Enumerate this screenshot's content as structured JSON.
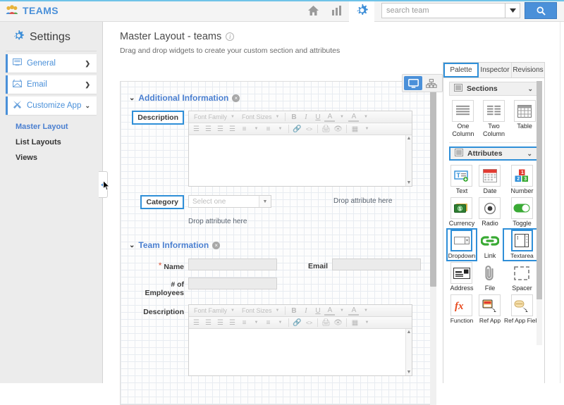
{
  "topbar": {
    "brand": "TEAMS",
    "icons": [
      "home-icon",
      "chart-icon",
      "gear-icon"
    ],
    "search": {
      "value": "search team",
      "placeholder": "search team"
    },
    "search_button": "search-icon"
  },
  "sidebar": {
    "title": "Settings",
    "items": [
      {
        "label": "General",
        "icon": "monitor-icon",
        "chevron": "❯"
      },
      {
        "label": "Email",
        "icon": "envelope-icon",
        "chevron": "❯"
      },
      {
        "label": "Customize App",
        "icon": "tools-icon",
        "chevron": "⌄"
      }
    ],
    "subitems": [
      {
        "label": "Master Layout",
        "active": true
      },
      {
        "label": "List Layouts",
        "active": false
      },
      {
        "label": "Views",
        "active": false
      }
    ]
  },
  "main": {
    "title": "Master Layout - teams",
    "info_icon": "i",
    "subtitle": "Drag and drop widgets to create your custom section and attributes",
    "device_toggle": [
      {
        "name": "desktop-view",
        "active": true
      },
      {
        "name": "responsive-view",
        "active": false
      }
    ]
  },
  "rte_toolbar": {
    "font_family": "Font Family",
    "font_sizes": "Font Sizes",
    "row1": [
      "B",
      "I",
      "U",
      "A",
      "A"
    ],
    "row2": [
      "align-left",
      "align-center",
      "align-right",
      "align-justify",
      "bullet-list",
      "number-list",
      "link",
      "code",
      "print",
      "preview",
      "table"
    ]
  },
  "sections": [
    {
      "name": "Additional Information",
      "delete": "×",
      "caret": "⌄",
      "fields": [
        {
          "label": "Description",
          "type": "richtext",
          "highlighted": true
        },
        {
          "label": "Category",
          "type": "select",
          "value": "Select one",
          "highlighted": true
        }
      ],
      "drop_hints": [
        "Drop attribute here",
        "Drop attribute here"
      ]
    },
    {
      "name": "Team Information",
      "delete": "×",
      "caret": "⌄",
      "fields": [
        {
          "label": "Name",
          "required": true,
          "type": "text"
        },
        {
          "label": "Email",
          "required": false,
          "type": "text"
        },
        {
          "label": "# of Employees",
          "required": false,
          "type": "text"
        },
        {
          "label": "Description",
          "type": "richtext",
          "highlighted": false
        }
      ]
    }
  ],
  "panel": {
    "tabs": [
      {
        "label": "Palette",
        "active": true
      },
      {
        "label": "Inspector",
        "active": false
      },
      {
        "label": "Revisions",
        "active": false
      }
    ],
    "groups": [
      {
        "title": "Sections",
        "icon": "section-icon",
        "caret": "⌄",
        "highlighted": false,
        "items": [
          {
            "label": "One Column",
            "icon": "one-column-icon",
            "highlighted": false
          },
          {
            "label": "Two Column",
            "icon": "two-column-icon",
            "highlighted": false
          },
          {
            "label": "Table",
            "icon": "table-icon",
            "highlighted": false
          }
        ]
      },
      {
        "title": "Attributes",
        "icon": "attributes-icon",
        "caret": "⌄",
        "highlighted": true,
        "items": [
          {
            "label": "Text",
            "icon": "text-field-icon",
            "highlighted": false
          },
          {
            "label": "Date",
            "icon": "calendar-icon",
            "highlighted": false
          },
          {
            "label": "Number",
            "icon": "number-blocks-icon",
            "highlighted": false
          },
          {
            "label": "Currency",
            "icon": "money-icon",
            "highlighted": false
          },
          {
            "label": "Radio",
            "icon": "radio-button-icon",
            "highlighted": false
          },
          {
            "label": "Toggle",
            "icon": "toggle-switch-icon",
            "highlighted": false
          },
          {
            "label": "Dropdown",
            "icon": "dropdown-icon",
            "highlighted": true
          },
          {
            "label": "Link",
            "icon": "link-chain-icon",
            "highlighted": false
          },
          {
            "label": "Textarea",
            "icon": "textarea-icon",
            "highlighted": true
          },
          {
            "label": "Address",
            "icon": "address-card-icon",
            "highlighted": false
          },
          {
            "label": "File",
            "icon": "paperclip-icon",
            "highlighted": false
          },
          {
            "label": "Spacer",
            "icon": "spacer-dashed-icon",
            "highlighted": false
          },
          {
            "label": "Function",
            "icon": "fx-icon",
            "highlighted": false
          },
          {
            "label": "Ref App",
            "icon": "ref-app-icon",
            "highlighted": false
          },
          {
            "label": "Ref App Field",
            "icon": "ref-app-field-icon",
            "highlighted": false
          }
        ]
      }
    ]
  },
  "colors": {
    "accent_blue": "#4a90d9",
    "highlight_blue": "#2f8fd8",
    "topbar_bg": "#f4f4f4",
    "sidebar_bg": "#ececec",
    "required_red": "#e05a3c"
  }
}
